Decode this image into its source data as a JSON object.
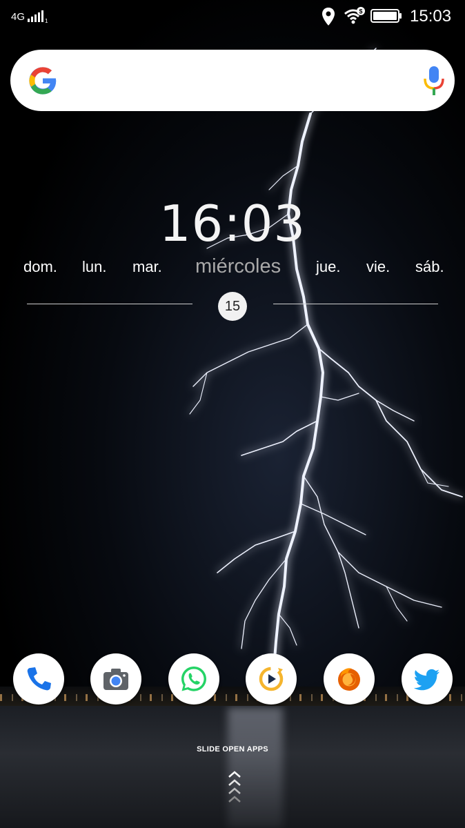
{
  "status_bar": {
    "network": "4G",
    "sim": "1",
    "icons": [
      "signal-icon",
      "location-icon",
      "wifi-icon",
      "battery-icon"
    ],
    "time": "15:03"
  },
  "search_bar": {
    "logo": "google-logo",
    "mic": "mic-icon"
  },
  "clock_widget": {
    "time": "16:03",
    "days": [
      "dom.",
      "lun.",
      "mar.",
      "miércoles",
      "jue.",
      "vie.",
      "sáb."
    ],
    "current_day_index": 3,
    "date": "15"
  },
  "dock": {
    "apps": [
      "phone-icon",
      "camera-icon",
      "whatsapp-icon",
      "video-player-icon",
      "firefox-icon",
      "twitter-icon"
    ]
  },
  "slide_hint": {
    "label": "SLIDE OPEN APPS",
    "icon": "chevron-up-icon"
  },
  "colors": {
    "google_blue": "#4285F4",
    "google_red": "#EA4335",
    "google_yellow": "#FBBC05",
    "google_green": "#34A853",
    "whatsapp": "#25D366",
    "twitter": "#1DA1F2",
    "firefox": "#E66000",
    "video_player": "#F5B52E"
  }
}
